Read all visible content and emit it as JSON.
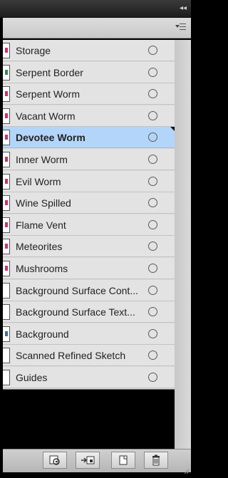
{
  "panel": {
    "layers": [
      {
        "label": "Storage",
        "thumb_color": "#d0306a"
      },
      {
        "label": "Serpent Border",
        "thumb_color": "#2e8b57"
      },
      {
        "label": "Serpent Worm",
        "thumb_color": "#d0306a"
      },
      {
        "label": "Vacant Worm",
        "thumb_color": "#d0306a"
      },
      {
        "label": "Devotee Worm",
        "thumb_color": "#d0306a",
        "selected": true
      },
      {
        "label": "Inner Worm",
        "thumb_color": "#d0306a"
      },
      {
        "label": "Evil Worm",
        "thumb_color": "#d0306a"
      },
      {
        "label": "Wine Spilled",
        "thumb_color": "#d0306a"
      },
      {
        "label": "Flame Vent",
        "thumb_color": "#d0306a"
      },
      {
        "label": "Meteorites",
        "thumb_color": "#d0306a"
      },
      {
        "label": "Mushrooms",
        "thumb_color": "#d0306a"
      },
      {
        "label": "Background Surface Cont...",
        "thumb_color": "#ffffff"
      },
      {
        "label": "Background Surface Text...",
        "thumb_color": "#ffffff"
      },
      {
        "label": "Background",
        "thumb_color": "#3a6ea5"
      },
      {
        "label": "Scanned Refined Sketch",
        "thumb_color": "#ffffff"
      },
      {
        "label": "Guides",
        "thumb_color": "#ffffff"
      }
    ],
    "footer_buttons": [
      "locate-object-icon",
      "create-sublayer-icon",
      "create-new-layer-icon",
      "delete-layer-icon"
    ],
    "colors": {
      "selected_row": "#b3d5fa",
      "row": "#e3e3e3"
    }
  }
}
